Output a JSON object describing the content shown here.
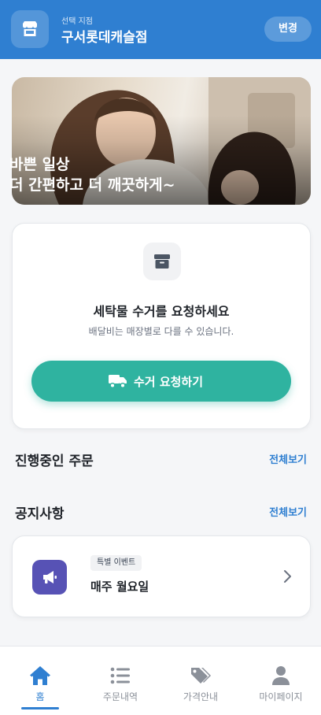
{
  "header": {
    "caption": "선택 지점",
    "store_name": "구서롯데캐슬점",
    "change_label": "변경"
  },
  "banner": {
    "line1": "바쁜 일상",
    "line2": "더 간편하고 더 깨끗하게~"
  },
  "pickup": {
    "title": "세탁물 수거를 요청하세요",
    "subtitle": "배달비는 매장별로 다를 수 있습니다.",
    "button_label": "수거 요청하기"
  },
  "orders": {
    "title": "진행중인 주문",
    "see_all": "전체보기"
  },
  "notices": {
    "title": "공지사항",
    "see_all": "전체보기",
    "items": [
      {
        "badge": "특별 이벤트",
        "title": "매주 월요일"
      }
    ]
  },
  "nav": {
    "items": [
      {
        "label": "홈",
        "icon": "home-icon",
        "active": true
      },
      {
        "label": "주문내역",
        "icon": "list-icon"
      },
      {
        "label": "가격안내",
        "icon": "tags-icon"
      },
      {
        "label": "마이페이지",
        "icon": "user-icon"
      }
    ]
  },
  "colors": {
    "brand_blue": "#2f7fd1",
    "accent_teal": "#2fb3a0",
    "notice_purple": "#5752b5"
  }
}
